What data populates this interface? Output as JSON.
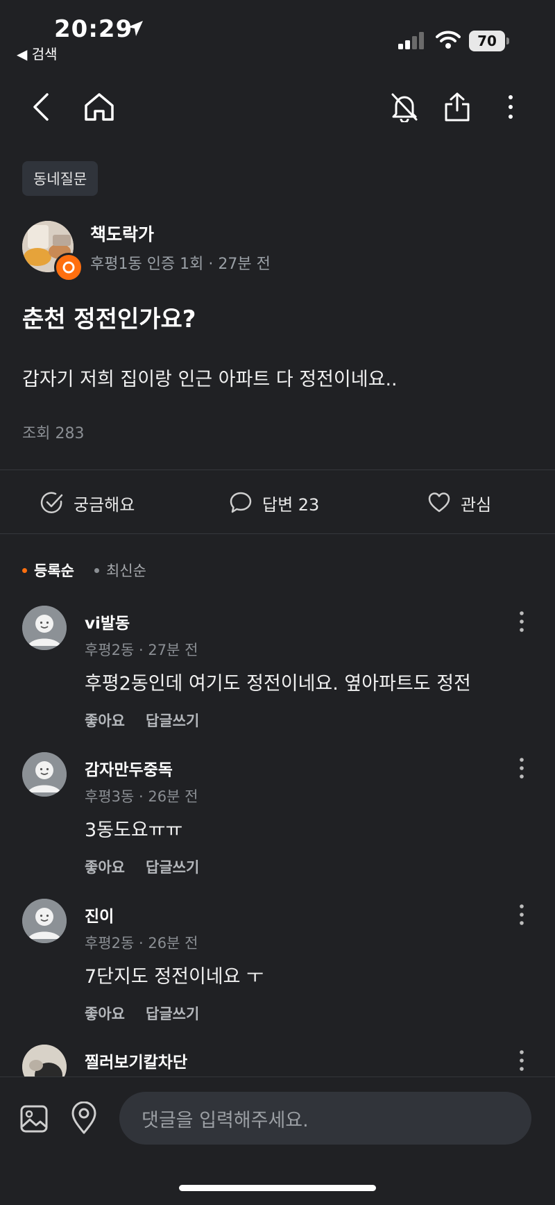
{
  "status": {
    "time": "20:29",
    "back_label": "◀ 검색",
    "battery": "70"
  },
  "post": {
    "category": "동네질문",
    "author": "책도락가",
    "author_meta": "후평1동 인증 1회 · 27분 전",
    "title": "춘천 정전인가요?",
    "body": "갑자기 저희 집이랑 인근 아파트 다 정전이네요..",
    "views": "조회 283"
  },
  "actions": {
    "curious": "궁금해요",
    "answers": "답변 23",
    "interest": "관심"
  },
  "sort": {
    "registered": "등록순",
    "latest": "최신순"
  },
  "comments": [
    {
      "name": "vi발동",
      "meta": "후평2동 · 27분 전",
      "text": "후평2동인데 여기도 정전이네요. 옆아파트도 정전",
      "like": "좋아요",
      "reply": "답글쓰기"
    },
    {
      "name": "감자만두중독",
      "meta": "후평3동 · 26분 전",
      "text": "3동도요ㅠㅠ",
      "like": "좋아요",
      "reply": "답글쓰기"
    },
    {
      "name": "진이",
      "meta": "후평2동 · 26분 전",
      "text": "7단지도 정전이네요 ㅜ",
      "like": "좋아요",
      "reply": "답글쓰기"
    },
    {
      "name": "찔러보기칼차단"
    }
  ],
  "input": {
    "placeholder": "댓글을 입력해주세요."
  },
  "colors": {
    "background": "#202124",
    "accent": "#ff6f0f"
  }
}
